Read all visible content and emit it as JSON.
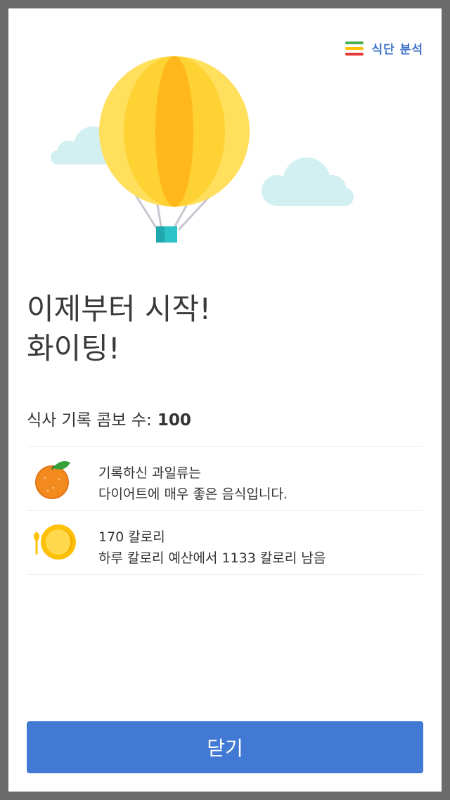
{
  "header": {
    "analysis_label": "식단 분석",
    "analysis_icon": "stacked-bars-icon"
  },
  "illustration": {
    "name": "hot-air-balloon-illustration",
    "colors": {
      "balloon": "#ffd233",
      "stripe": "#ffb71c",
      "basket": "#2bc2c8",
      "cloud": "#d2eff2"
    }
  },
  "headline": {
    "line1": "이제부터 시작!",
    "line2": "화이팅!"
  },
  "combo": {
    "label": "식사 기록 콤보 수:",
    "value": "100"
  },
  "feedback": [
    {
      "icon": "orange-icon",
      "line1": "기록하신 과일류는",
      "line2": "다이어트에 매우 좋은 음식입니다."
    },
    {
      "icon": "plate-spoon-icon",
      "line1": "170 칼로리",
      "line2": "하루 칼로리 예산에서 1133 칼로리 남음"
    }
  ],
  "footer": {
    "close_label": "닫기"
  },
  "colors": {
    "accent": "#4279d4",
    "link": "#3f73c9"
  }
}
